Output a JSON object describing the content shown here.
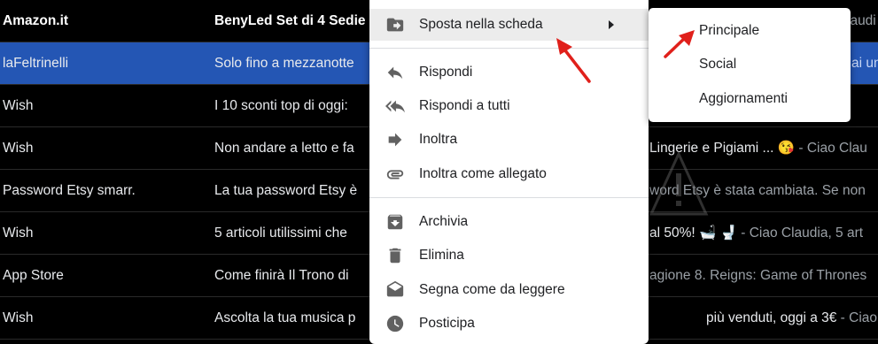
{
  "emails": [
    {
      "sender": "Amazon.it",
      "subject": "BenyLed Set di 4 Sedie",
      "tail_subject": "",
      "tail_snippet": "laudi",
      "unread": true,
      "selected": false
    },
    {
      "sender": "laFeltrinelli",
      "subject": "Solo fino a mezzanotte",
      "tail_subject": "",
      "tail_snippet": "ai un",
      "unread": false,
      "selected": true
    },
    {
      "sender": "Wish",
      "subject": "I 10 sconti top di oggi:",
      "tail_subject": "",
      "tail_snippet": "",
      "unread": false,
      "selected": false
    },
    {
      "sender": "Wish",
      "subject": "Non andare a letto e fa",
      "tail_subject": "Lingerie e Pigiami ... 😘",
      "tail_snippet": " - Ciao Clau",
      "unread": false,
      "selected": false
    },
    {
      "sender": "Password Etsy smarr.",
      "subject": "La tua password Etsy è",
      "tail_subject": "",
      "tail_snippet": "word Etsy è stata cambiata. Se non",
      "unread": false,
      "selected": false
    },
    {
      "sender": "Wish",
      "subject": "5 articoli utilissimi che",
      "tail_subject": "al 50%! 🛁 🚽",
      "tail_snippet": " - Ciao Claudia, 5 art",
      "unread": false,
      "selected": false
    },
    {
      "sender": "App Store",
      "subject": "Come finirà Il Trono di",
      "tail_subject": "",
      "tail_snippet": "agione 8. Reigns: Game of Thrones",
      "unread": false,
      "selected": false
    },
    {
      "sender": "Wish",
      "subject": "Ascolta la tua musica p",
      "tail_subject": "più venduti, oggi a 3€",
      "tail_snippet": " - Ciao Clau",
      "unread": false,
      "selected": false
    }
  ],
  "context_menu": {
    "move_to_tab": {
      "label": "Sposta nella scheda",
      "icon": "move-to-tab-icon"
    },
    "reply": {
      "label": "Rispondi",
      "icon": "reply-icon"
    },
    "reply_all": {
      "label": "Rispondi a tutti",
      "icon": "reply-all-icon"
    },
    "forward": {
      "label": "Inoltra",
      "icon": "forward-icon"
    },
    "forward_attachment": {
      "label": "Inoltra come allegato",
      "icon": "attachment-icon"
    },
    "archive": {
      "label": "Archivia",
      "icon": "archive-icon"
    },
    "delete": {
      "label": "Elimina",
      "icon": "trash-icon"
    },
    "mark_read": {
      "label": "Segna come da leggere",
      "icon": "mark-unread-icon"
    },
    "snooze": {
      "label": "Posticipa",
      "icon": "clock-icon"
    }
  },
  "submenu": {
    "primary": "Principale",
    "social": "Social",
    "updates": "Aggiornamenti"
  },
  "colors": {
    "selected_row": "#2456b4",
    "annotation_arrow": "#e0201b",
    "menu_icon": "#616161"
  }
}
